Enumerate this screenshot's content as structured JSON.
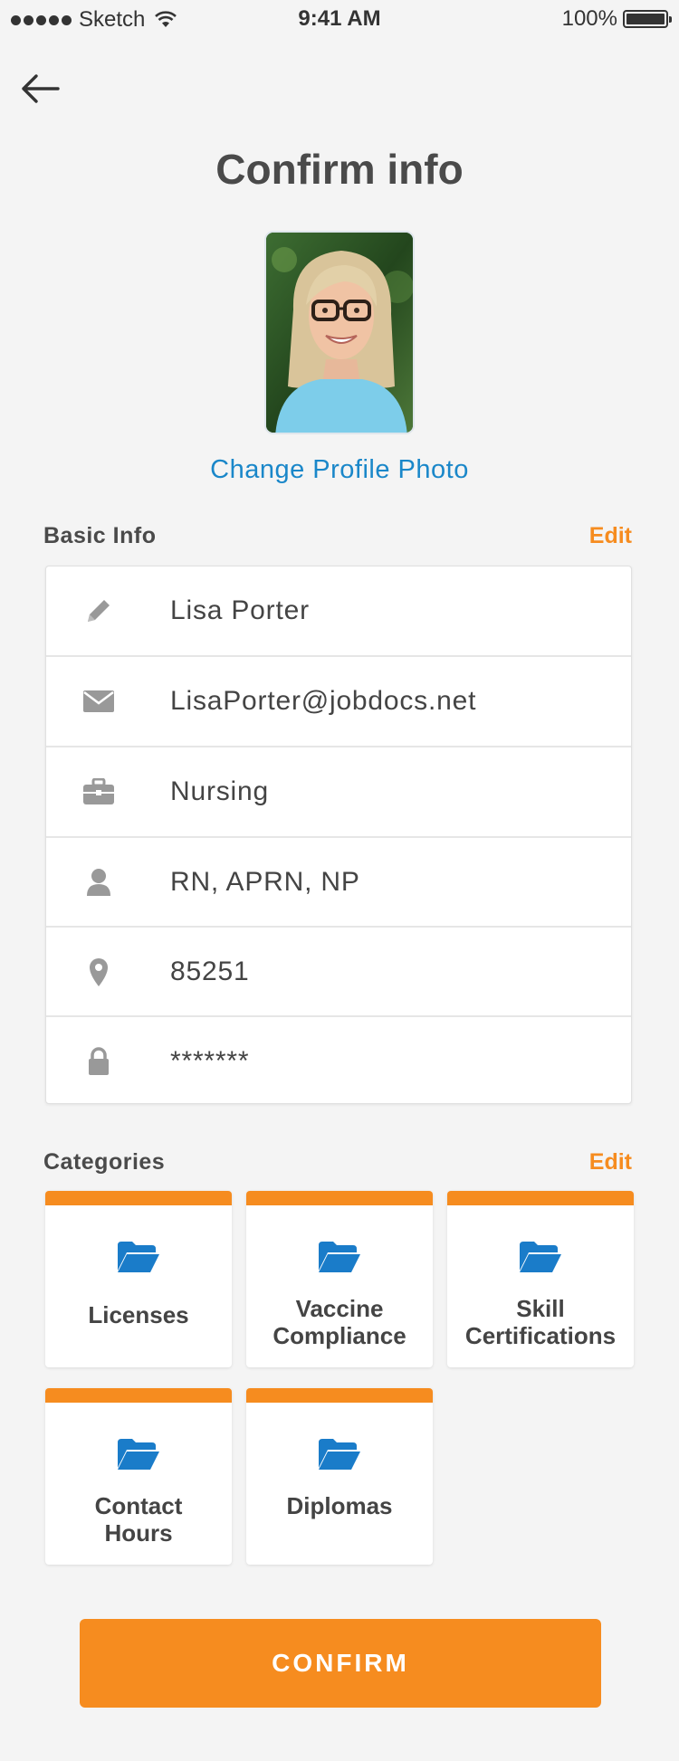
{
  "status_bar": {
    "carrier": "Sketch",
    "time": "9:41 AM",
    "battery": "100%"
  },
  "header": {
    "title": "Confirm info",
    "back_icon": "arrow-left-icon"
  },
  "profile": {
    "change_photo_label": "Change Profile Photo"
  },
  "basic_info": {
    "title": "Basic Info",
    "edit_label": "Edit",
    "rows": [
      {
        "icon": "pencil-icon",
        "value": "Lisa Porter"
      },
      {
        "icon": "envelope-icon",
        "value": "LisaPorter@jobdocs.net"
      },
      {
        "icon": "briefcase-icon",
        "value": "Nursing"
      },
      {
        "icon": "person-icon",
        "value": "RN, APRN, NP"
      },
      {
        "icon": "map-pin-icon",
        "value": "85251"
      },
      {
        "icon": "lock-icon",
        "value": "*******"
      }
    ]
  },
  "categories": {
    "title": "Categories",
    "edit_label": "Edit",
    "items": [
      {
        "label": "Licenses"
      },
      {
        "label": "Vaccine Compliance"
      },
      {
        "label": "Skill Certifications"
      },
      {
        "label": "Contact Hours"
      },
      {
        "label": "Diplomas"
      }
    ]
  },
  "confirm_label": "CONFIRM",
  "colors": {
    "accent": "#f68c1f",
    "link": "#1a87c9",
    "folder": "#1a7cc9"
  }
}
